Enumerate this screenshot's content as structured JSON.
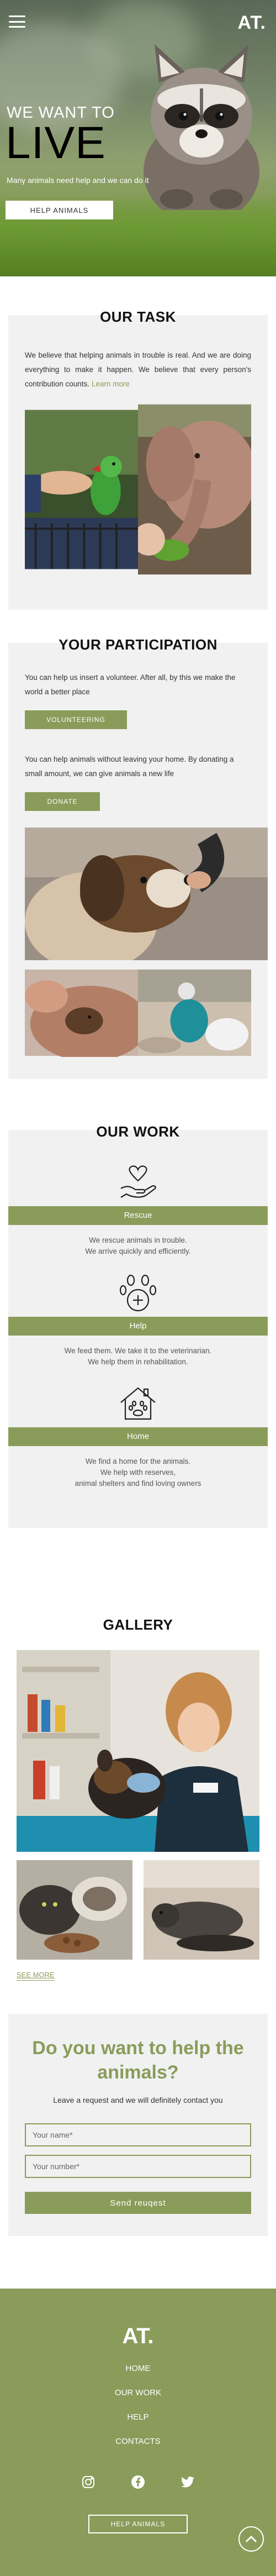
{
  "header": {
    "logo": "AT.",
    "menu_icon": "hamburger-menu-icon"
  },
  "hero": {
    "subtitle": "WE WANT TO",
    "title": "LIVE",
    "description": "Many animals need help and we can do it",
    "button": "HELP ANIMALS",
    "photo": "raccoon-photo"
  },
  "task": {
    "title": "OUR TASK",
    "text": "We believe that helping animals in trouble is real. And we are doing everything to make it happen. We believe that every person's contribution counts.",
    "link": "Learn more",
    "photos": [
      "parrot-feeding-photo",
      "elephant-photo"
    ]
  },
  "participation": {
    "title": "YOUR PARTICIPATION",
    "text1": "You can help us insert a volunteer. After all, by this we make the world a better place",
    "button1": "VOLUNTEERING",
    "text2": "You can help animals without leaving your home. By donating a small amount, we can give animals a new life",
    "button2": "DONATE",
    "photos": [
      "dog-photo",
      "small-animal-photo",
      "beach-cleanup-photo"
    ]
  },
  "work": {
    "title": "OUR WORK",
    "items": [
      {
        "icon": "heart-hand-icon",
        "label": "Rescue",
        "line1": "We rescue animals in trouble.",
        "line2": "We arrive quickly and efficiently."
      },
      {
        "icon": "paw-plus-icon",
        "label": "Help",
        "line1": "We feed them. We take it to the veterinarian.",
        "line2": "We help them in rehabilitation."
      },
      {
        "icon": "house-paw-icon",
        "label": "Home",
        "line1": "We find a home for the animals.",
        "line2": "We help with reserves,",
        "line3": "animal shelters and find loving owners"
      }
    ]
  },
  "gallery": {
    "title": "GALLERY",
    "see_more": "SEE MORE",
    "photos": [
      "vet-with-dog-photo",
      "kittens-photo",
      "seal-photo"
    ]
  },
  "form": {
    "title": "Do you want to help the animals?",
    "subtitle": "Leave a request and we will definitely contact you",
    "name_placeholder": "Your name*",
    "number_placeholder": "Your number*",
    "send": "Send reuqest"
  },
  "footer": {
    "logo": "AT.",
    "nav": [
      "HOME",
      "OUR WORK",
      "HELP",
      "CONTACTS"
    ],
    "socials": [
      "instagram-icon",
      "facebook-icon",
      "twitter-icon"
    ],
    "button": "HELP ANIMALS",
    "to_top_icon": "chevron-up-circle-icon"
  },
  "colors": {
    "accent": "#8a9c5a",
    "card_bg": "#f1f1f1"
  }
}
